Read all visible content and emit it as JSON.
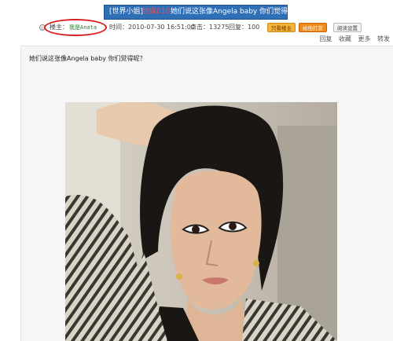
{
  "thread": {
    "tag": "[世界小姐]",
    "forum": "世娱010",
    "title": "她们说这张像Angela baby 你们觉得呢？"
  },
  "meta": {
    "author_label": "楼主：",
    "author": "我是Anata",
    "time_label": "时间：",
    "time": "2010-07-30 16:51:00",
    "views_label": "点击：",
    "views": "13275",
    "replies_label": "回复：",
    "replies": "100"
  },
  "buttons": {
    "only_author": "只看楼主",
    "reward": "给他打赏",
    "settings": "阅读设置"
  },
  "actions": [
    "回复",
    "收藏",
    "更多",
    "转发"
  ],
  "post": {
    "text": "她们说这张像Angela baby 你们觉得呢？"
  },
  "colors": {
    "title_bg": "#2f6fb5",
    "highlight_circle": "#d81b1b",
    "author": "#2b7a2b"
  }
}
